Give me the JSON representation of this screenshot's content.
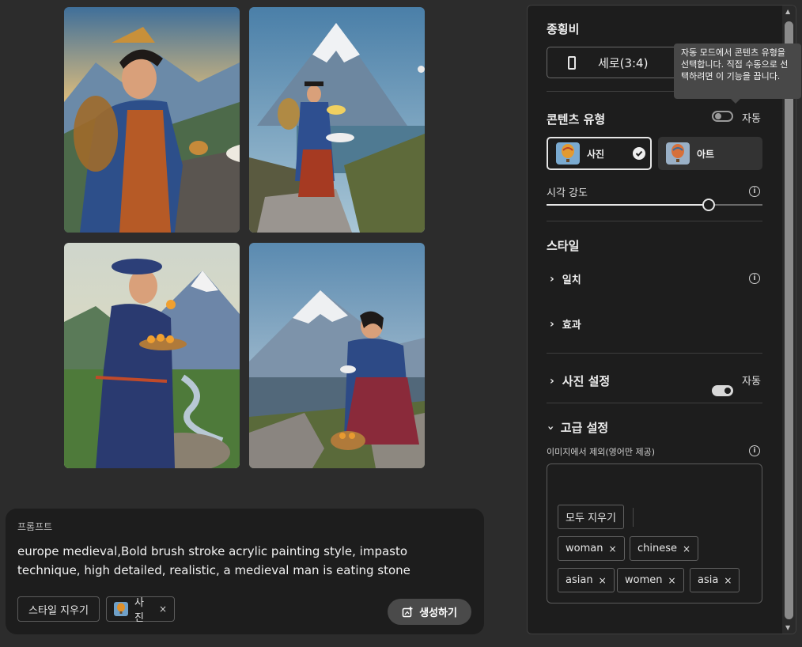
{
  "gallery": {
    "images": [
      "image-1",
      "image-2",
      "image-3",
      "image-4"
    ]
  },
  "prompt": {
    "label": "프롬프트",
    "text": "europe medieval,Bold brush stroke acrylic painting style, impasto technique, high detailed, realistic, a medieval man is eating stone",
    "clear_style_label": "스타일 지우기",
    "style_chip_label": "사진",
    "remove_symbol": "×",
    "generate_label": "생성하기"
  },
  "panel": {
    "aspect_ratio": {
      "title": "종횡비",
      "value": "세로(3:4)"
    },
    "tooltip": "자동 모드에서 콘텐츠 유형을 선택합니다. 직접 수동으로 선택하려면 이 기능을 끕니다.",
    "content_type": {
      "title": "콘텐츠 유형",
      "auto_label": "자동",
      "auto_on": false,
      "options": [
        {
          "label": "사진",
          "selected": true
        },
        {
          "label": "아트",
          "selected": false
        }
      ]
    },
    "visual_intensity": {
      "label": "시각 강도",
      "value_fraction": 0.75
    },
    "style": {
      "title": "스타일",
      "items": [
        {
          "label": "일치",
          "info": true
        },
        {
          "label": "효과",
          "info": false
        }
      ]
    },
    "photo_settings": {
      "title": "사진 설정",
      "auto_label": "자동",
      "auto_on": true
    },
    "advanced": {
      "title": "고급 설정",
      "exclude_label": "이미지에서 제외(영어만 제공)",
      "clear_all_label": "모두 지우기",
      "tags": [
        "woman",
        "chinese",
        "asian",
        "women",
        "asia"
      ],
      "remove_symbol": "×"
    }
  },
  "colors": {
    "panel_bg": "#1d1d1d",
    "page_bg": "#2c2c2c",
    "tooltip_bg": "#484848"
  }
}
